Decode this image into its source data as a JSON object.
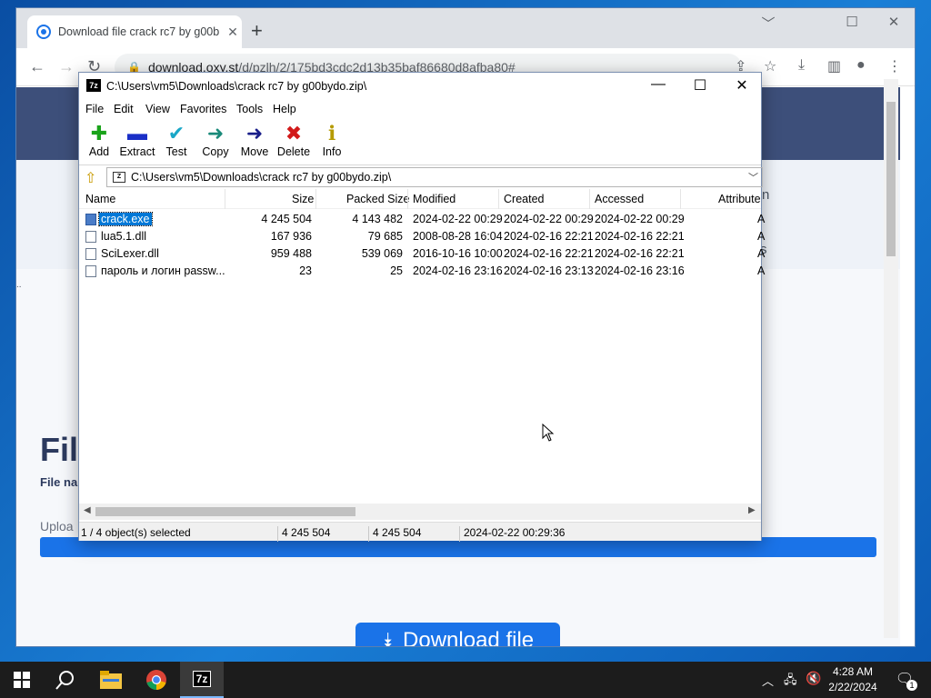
{
  "browser": {
    "tab_title": "Download file crack rc7 by g00b",
    "tab_close": "✕",
    "new_tab": "+",
    "url_host": "download.oxy.st",
    "url_path": "/d/pzlh/2/175bd3cdc2d13b35baf86680d8afba80#",
    "window_controls": [
      "﹀",
      "☐",
      "✕"
    ]
  },
  "webpage": {
    "title_fragment": "Fil",
    "file_name_label": "File na",
    "upload_label": "Uploa",
    "side_fragment_1": "n",
    "side_fragment_2": "s",
    "dots": "..",
    "download_button": "Download file",
    "download_icon": "chevrons-down-icon"
  },
  "sevenzip": {
    "title": "C:\\Users\\vm5\\Downloads\\crack rc7 by g00bydo.zip\\",
    "app_icon": "7z",
    "menu": [
      "File",
      "Edit",
      "View",
      "Favorites",
      "Tools",
      "Help"
    ],
    "toolbar": [
      {
        "label": "Add",
        "icon": "plus-icon",
        "glyph": "✚",
        "color": "#1aa31a"
      },
      {
        "label": "Extract",
        "icon": "minus-icon",
        "glyph": "▬",
        "color": "#1a2fc7"
      },
      {
        "label": "Test",
        "icon": "check-icon",
        "glyph": "✔",
        "color": "#1aa7c7"
      },
      {
        "label": "Copy",
        "icon": "arrow-right-teal-icon",
        "glyph": "➜",
        "color": "#1a8a7a"
      },
      {
        "label": "Move",
        "icon": "arrow-right-blue-icon",
        "glyph": "➜",
        "color": "#1a1f8a"
      },
      {
        "label": "Delete",
        "icon": "delete-x-icon",
        "glyph": "✖",
        "color": "#d21a1a"
      },
      {
        "label": "Info",
        "icon": "info-icon",
        "glyph": "ℹ",
        "color": "#b59a00"
      }
    ],
    "address": "C:\\Users\\vm5\\Downloads\\crack rc7 by g00bydo.zip\\",
    "columns": [
      "Name",
      "Size",
      "Packed Size",
      "Modified",
      "Created",
      "Accessed",
      "Attribute"
    ],
    "files": [
      {
        "name": "crack.exe",
        "size": "4 245 504",
        "packed": "4 143 482",
        "modified": "2024-02-22 00:29",
        "created": "2024-02-22 00:29",
        "accessed": "2024-02-22 00:29",
        "attr": "A",
        "type": "exe",
        "selected": true
      },
      {
        "name": "lua5.1.dll",
        "size": "167 936",
        "packed": "79 685",
        "modified": "2008-08-28 16:04",
        "created": "2024-02-16 22:21",
        "accessed": "2024-02-16 22:21",
        "attr": "A",
        "type": "dll",
        "selected": false
      },
      {
        "name": "SciLexer.dll",
        "size": "959 488",
        "packed": "539 069",
        "modified": "2016-10-16 10:00",
        "created": "2024-02-16 22:21",
        "accessed": "2024-02-16 22:21",
        "attr": "A",
        "type": "dll",
        "selected": false
      },
      {
        "name": "пароль и логин passw...",
        "size": "23",
        "packed": "25",
        "modified": "2024-02-16 23:16",
        "created": "2024-02-16 23:13",
        "accessed": "2024-02-16 23:16",
        "attr": "A",
        "type": "txt",
        "selected": false
      }
    ],
    "status": {
      "selection": "1 / 4 object(s) selected",
      "size": "4 245 504",
      "packed": "4 245 504",
      "date": "2024-02-22 00:29:36"
    }
  },
  "taskbar": {
    "time": "4:28 AM",
    "date": "2/22/2024",
    "notifications": "1",
    "apps": [
      "windows-start-icon",
      "search-icon",
      "file-explorer-icon",
      "chrome-icon",
      "7zip-icon"
    ]
  }
}
